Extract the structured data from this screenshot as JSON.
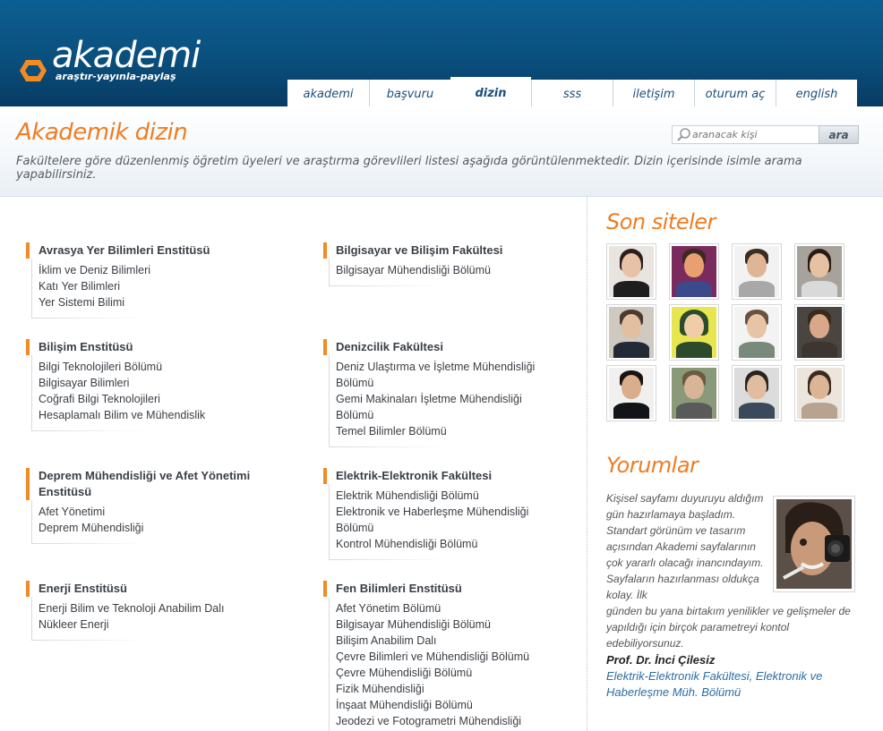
{
  "brand": {
    "name": "akademi",
    "tagline": "araştır-yayınla-paylaş",
    "accent": "#ef7d23",
    "header_color": "#0a4f7d"
  },
  "nav": {
    "tabs": [
      {
        "label": "akademi",
        "active": false
      },
      {
        "label": "başvuru",
        "active": false
      },
      {
        "label": "dizin",
        "active": true
      },
      {
        "label": "sss",
        "active": false
      },
      {
        "label": "iletişim",
        "active": false
      },
      {
        "label": "oturum aç",
        "active": false
      },
      {
        "label": "english",
        "active": false
      }
    ]
  },
  "intro": {
    "title": "Akademik dizin",
    "description": "Fakültelere göre düzenlenmiş öğretim üyeleri ve araştırma görevlileri listesi aşağıda görüntülenmektedir. Dizin içerisinde isimle arama yapabilirsiniz."
  },
  "search": {
    "placeholder": "aranacak kişi",
    "button_label": "ara"
  },
  "faculties": [
    {
      "title": "Avrasya Yer Bilimleri Enstitüsü",
      "items": [
        "İklim ve Deniz Bilimleri",
        "Katı Yer Bilimleri",
        "Yer Sistemi Bilimi"
      ]
    },
    {
      "title": "Bilgisayar ve Bilişim Fakültesi",
      "items": [
        "Bilgisayar Mühendisliği Bölümü"
      ]
    },
    {
      "title": "Bilişim Enstitüsü",
      "items": [
        "Bilgi Teknolojileri Bölümü",
        "Bilgisayar Bilimleri",
        "Coğrafi Bilgi Teknolojileri",
        "Hesaplamalı Bilim ve Mühendislik"
      ]
    },
    {
      "title": "Denizcilik Fakültesi",
      "items": [
        "Deniz Ulaştırma ve İşletme Mühendisliği",
        "Bölümü",
        "Gemi Makinaları İşletme Mühendisliği",
        "Bölümü",
        "Temel Bilimler Bölümü"
      ]
    },
    {
      "title_lines": [
        "Deprem Mühendisliği ve Afet Yönetimi",
        "Enstitüsü"
      ],
      "items": [
        "Afet Yönetimi",
        "Deprem Mühendisliği"
      ]
    },
    {
      "title": "Elektrik-Elektronik Fakültesi",
      "items": [
        "Elektrik Mühendisliği Bölümü",
        "Elektronik ve Haberleşme Mühendisliği",
        "Bölümü",
        "Kontrol Mühendisliği Bölümü"
      ]
    },
    {
      "title": "Enerji Enstitüsü",
      "items": [
        "Enerji Bilim ve Teknoloji Anabilim Dalı",
        "Nükleer Enerji"
      ]
    },
    {
      "title": "Fen Bilimleri Enstitüsü",
      "items": [
        "Afet Yönetim Bölümü",
        "Bilgisayar Mühendisliği Bölümü",
        "Bilişim Anabilim Dalı",
        "Çevre Bilimleri ve Mühendisliği Bölümü",
        "Çevre Mühendisliği Bölümü",
        "Fizik Mühendisliği",
        "İnşaat Mühendisliği Bölümü",
        "Jeodezi ve Fotogrametri Mühendisliği"
      ]
    }
  ],
  "sidebar": {
    "recent_heading": "Son siteler",
    "comments_heading": "Yorumlar",
    "comment": {
      "text": "Kişisel sayfamı duyuruyu aldığım gün hazırlamaya başladım. Standart görünüm ve tasarım açısından Akademi sayfalarının çok yararlı olacağı inancındayım. Sayfaların hazırlanması oldukça kolay. İlk",
      "text_tail": "günden bu yana birtakım yenilikler ve gelişmeler de yapıldığı için birçok parametreyi kontol edebiliyorsunuz.",
      "author": "Prof. Dr. İnci Çilesiz",
      "affiliation": "Elektrik-Elektronik Fakültesi, Elektronik ve Haberleşme Müh. Bölümü"
    }
  }
}
